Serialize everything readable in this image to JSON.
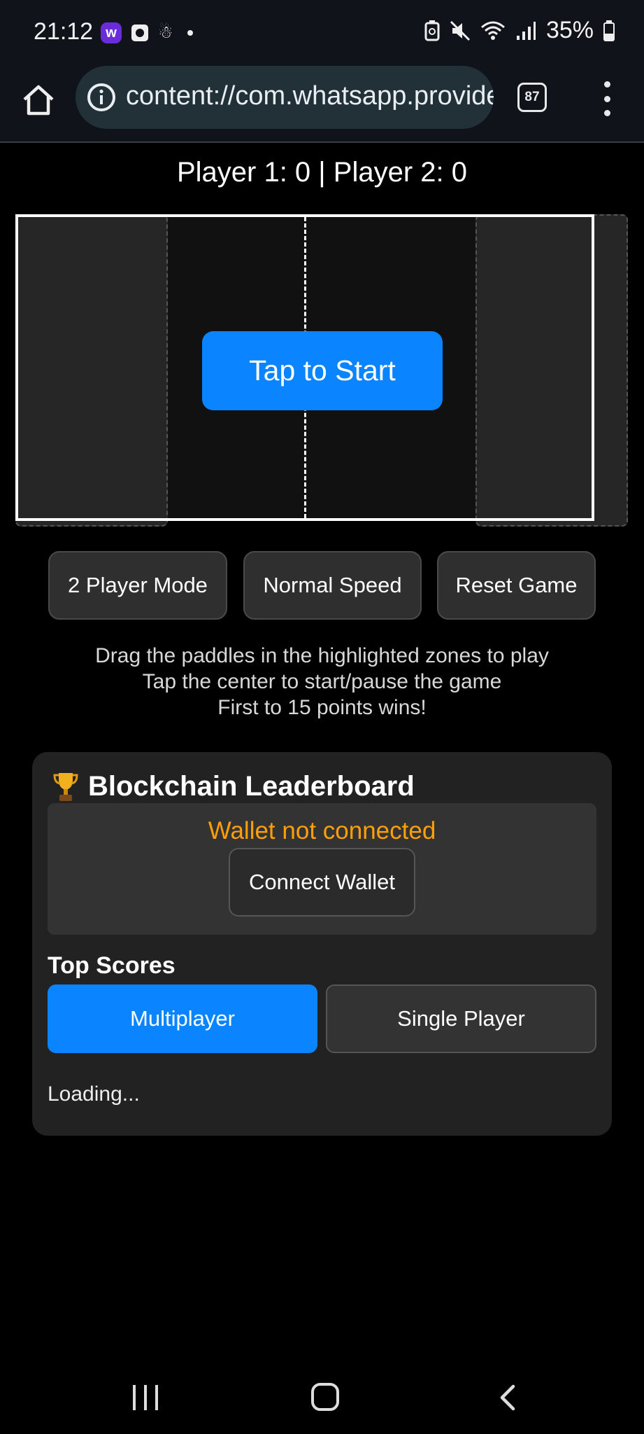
{
  "status_bar": {
    "time": "21:12",
    "app_badge": "w",
    "battery_percent": "35%"
  },
  "browser": {
    "url": "content://com.whatsapp.provider.media",
    "tab_count": "87"
  },
  "game": {
    "score": "Player 1: 0 | Player 2: 0",
    "start_label": "Tap to Start"
  },
  "controls": {
    "mode_label": "2 Player Mode",
    "speed_label": "Normal Speed",
    "reset_label": "Reset Game"
  },
  "instructions": {
    "line1": "Drag the paddles in the highlighted zones to play",
    "line2": "Tap the center to start/pause the game",
    "line3": "First to 15 points wins!"
  },
  "leaderboard": {
    "title": "Blockchain Leaderboard",
    "wallet_status": "Wallet not connected",
    "connect_label": "Connect Wallet",
    "top_scores_heading": "Top Scores",
    "tabs": [
      {
        "label": "Multiplayer",
        "active": true
      },
      {
        "label": "Single Player",
        "active": false
      }
    ],
    "loading_text": "Loading..."
  },
  "colors": {
    "accent": "#0a84ff",
    "warning": "#ff9f0a"
  },
  "icons": [
    "home-icon",
    "info-icon",
    "tabs-icon",
    "more-vert-icon",
    "trophy-icon",
    "recent-apps-icon",
    "nav-home-icon",
    "back-icon"
  ]
}
